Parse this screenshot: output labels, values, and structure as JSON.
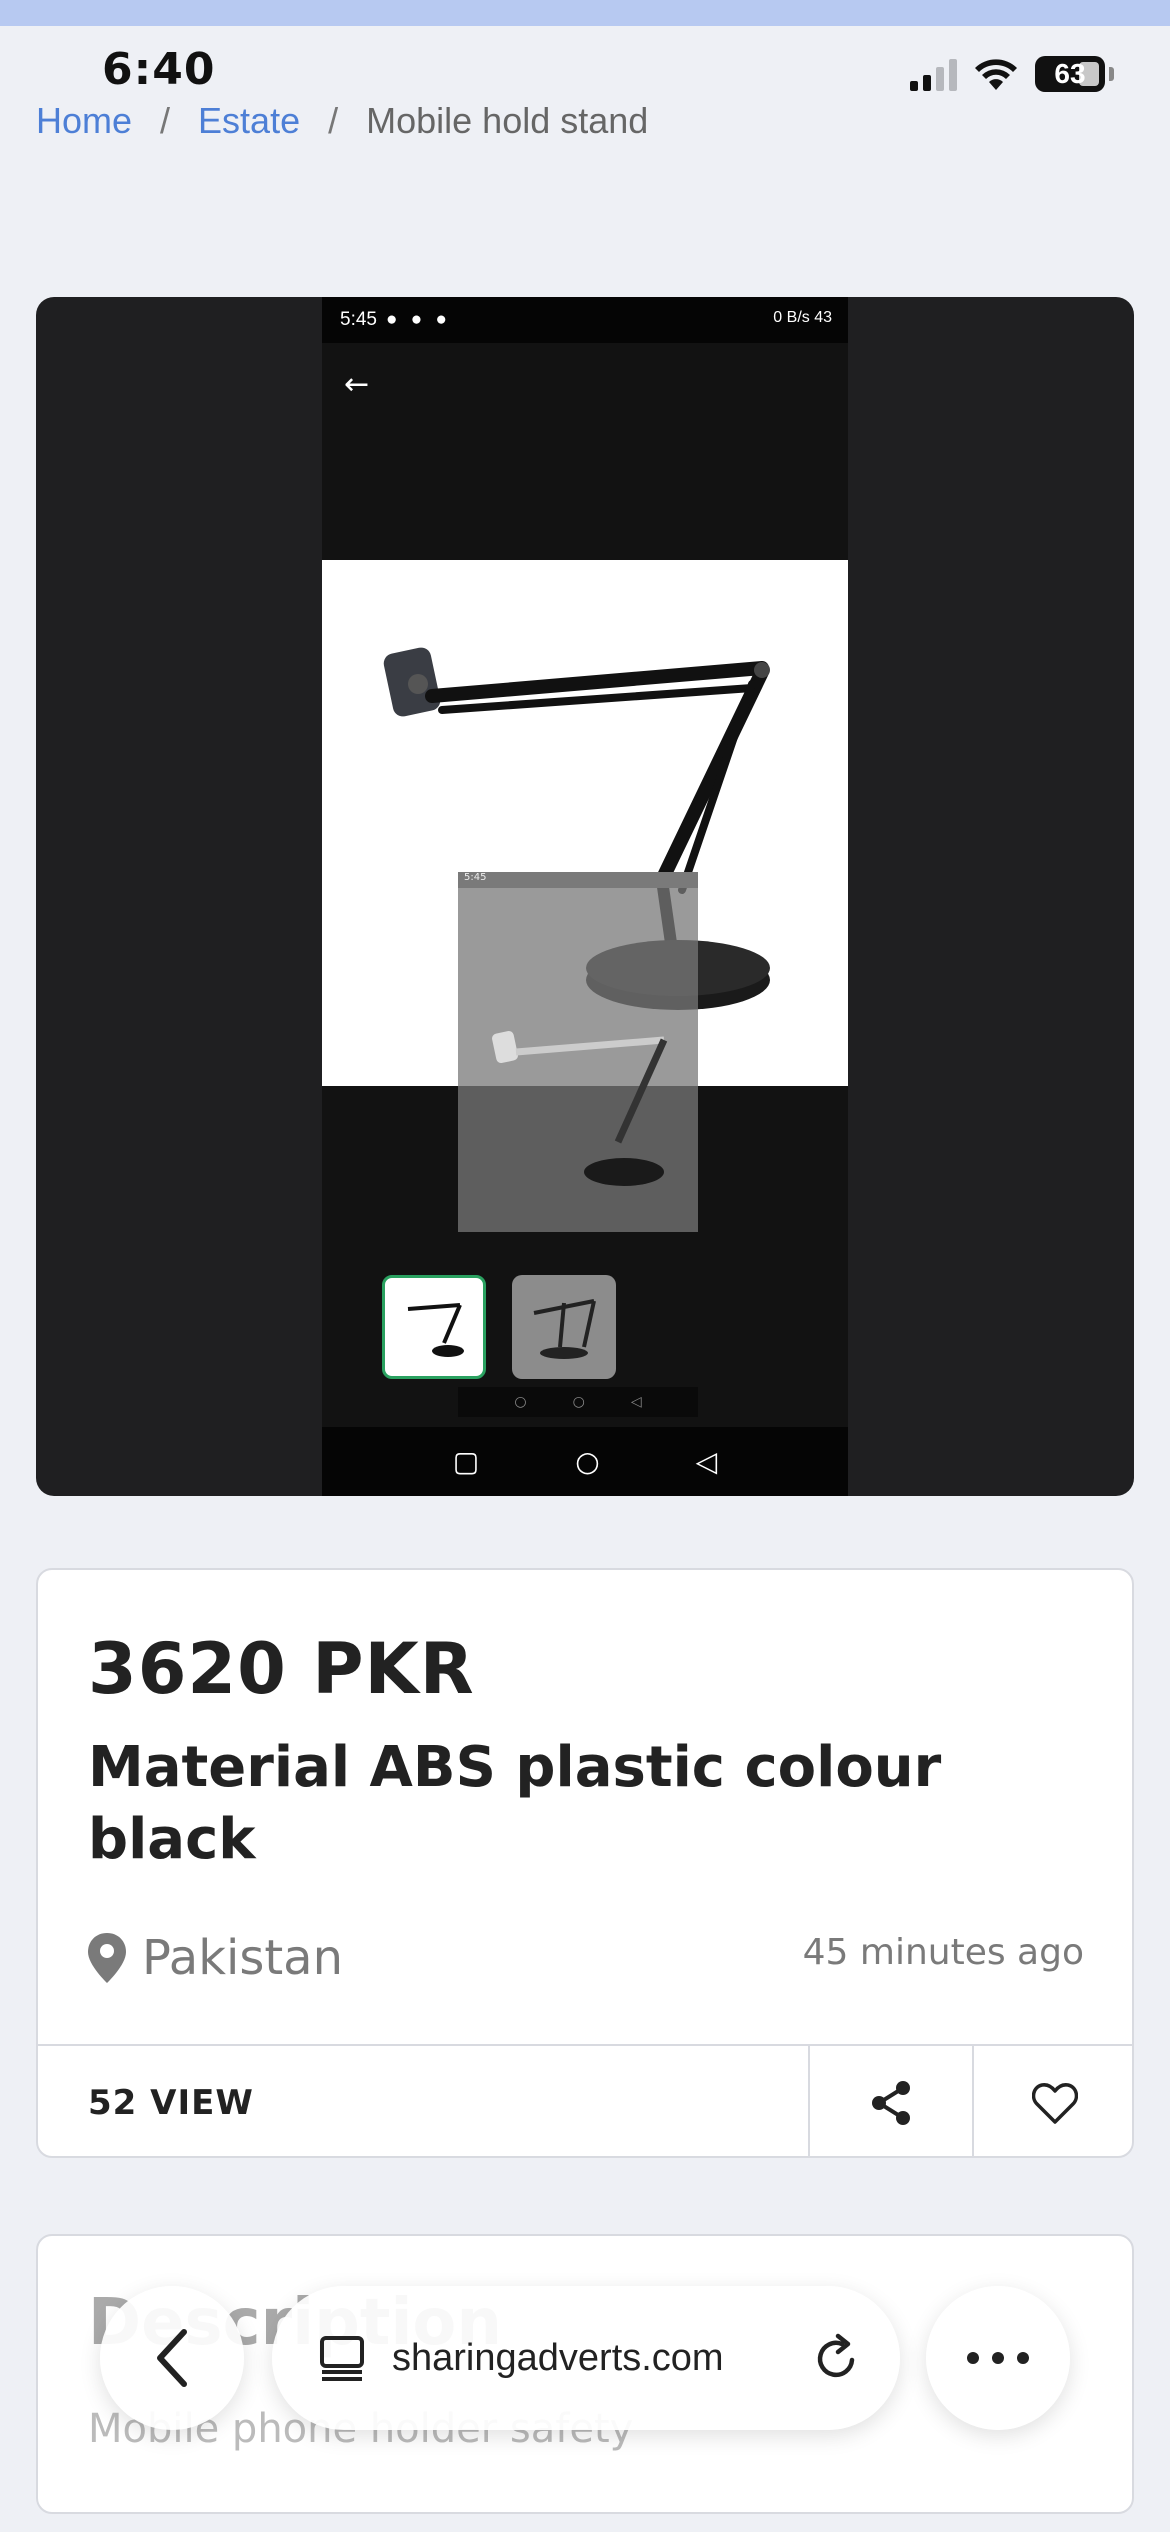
{
  "status": {
    "time": "6:40",
    "battery": "63"
  },
  "breadcrumb": {
    "home": "Home",
    "separator": "/",
    "category": "Estate",
    "current": "Mobile hold stand"
  },
  "gallery": {
    "inner_screenshot": {
      "time": "5:45",
      "status_right": "0 B/s 43"
    },
    "thumbnails_count_visible": 2
  },
  "listing": {
    "price": "3620 PKR",
    "title": "Material ABS plastic colour black",
    "location": "Pakistan",
    "time_ago": "45 minutes ago",
    "views": "52 VIEW"
  },
  "description": {
    "title": "Description",
    "text": "Mobile phone holder safety"
  },
  "browser": {
    "url": "sharingadverts.com"
  },
  "colors": {
    "link": "#4d7fd6",
    "accent_green": "#2aa160",
    "card_border": "#d8dae0"
  },
  "icons": [
    "location-pin-icon",
    "share-icon",
    "heart-icon",
    "back-chevron-icon",
    "tabs-icon",
    "reload-icon",
    "more-icon"
  ]
}
